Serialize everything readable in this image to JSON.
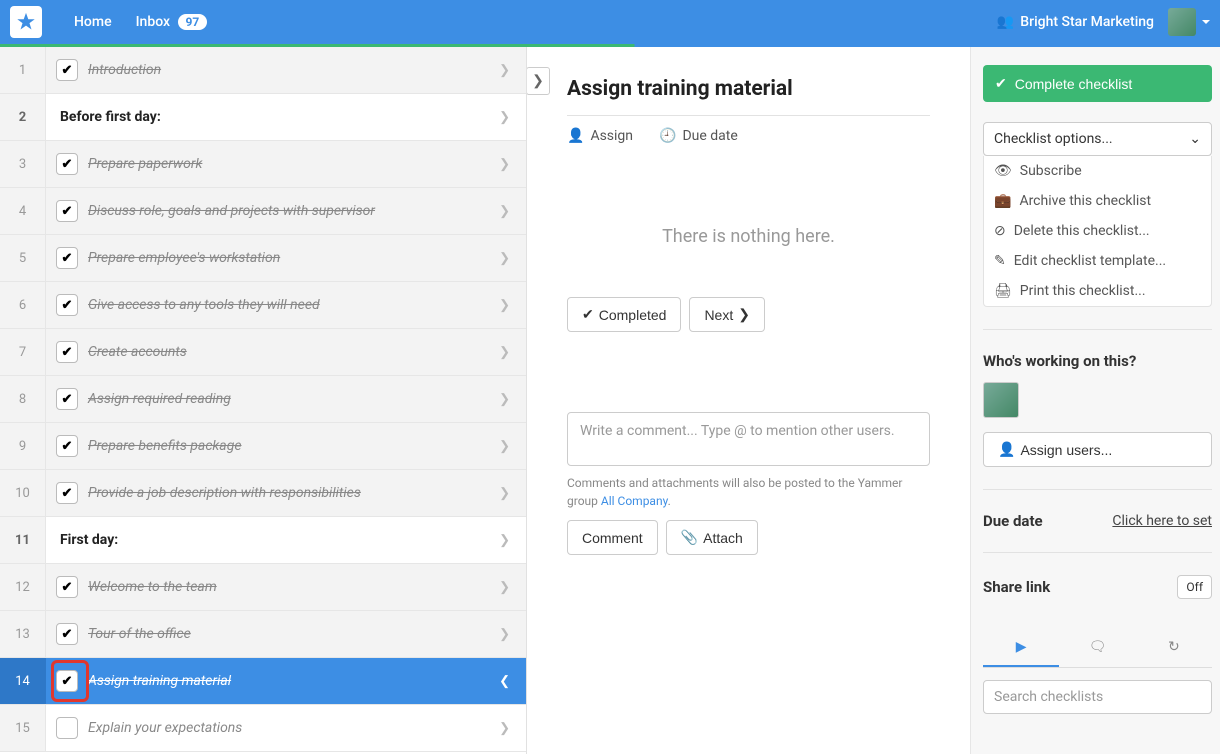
{
  "topbar": {
    "home": "Home",
    "inbox": "Inbox",
    "inbox_count": "97",
    "org_name": "Bright Star Marketing"
  },
  "tasks": [
    {
      "num": "1",
      "title": "Introduction",
      "checked": true,
      "done": true,
      "header": false
    },
    {
      "num": "2",
      "title": "Before first day:",
      "checked": false,
      "done": false,
      "header": true
    },
    {
      "num": "3",
      "title": "Prepare paperwork",
      "checked": true,
      "done": true,
      "header": false
    },
    {
      "num": "4",
      "title": "Discuss role, goals and projects with supervisor",
      "checked": true,
      "done": true,
      "header": false
    },
    {
      "num": "5",
      "title": "Prepare employee's workstation",
      "checked": true,
      "done": true,
      "header": false
    },
    {
      "num": "6",
      "title": "Give access to any tools they will need",
      "checked": true,
      "done": true,
      "header": false
    },
    {
      "num": "7",
      "title": "Create accounts",
      "checked": true,
      "done": true,
      "header": false
    },
    {
      "num": "8",
      "title": "Assign required reading",
      "checked": true,
      "done": true,
      "header": false
    },
    {
      "num": "9",
      "title": "Prepare benefits package",
      "checked": true,
      "done": true,
      "header": false
    },
    {
      "num": "10",
      "title": "Provide a job description with responsibilities",
      "checked": true,
      "done": true,
      "header": false
    },
    {
      "num": "11",
      "title": "First day:",
      "checked": false,
      "done": false,
      "header": true
    },
    {
      "num": "12",
      "title": "Welcome to the team",
      "checked": true,
      "done": true,
      "header": false
    },
    {
      "num": "13",
      "title": "Tour of the office",
      "checked": true,
      "done": true,
      "header": false
    },
    {
      "num": "14",
      "title": "Assign training material",
      "checked": true,
      "done": true,
      "header": false,
      "selected": true
    },
    {
      "num": "15",
      "title": "Explain your expectations",
      "checked": false,
      "done": false,
      "header": false
    }
  ],
  "detail": {
    "title": "Assign training material",
    "assign_label": "Assign",
    "duedate_label": "Due date",
    "empty": "There is nothing here.",
    "completed_btn": "Completed",
    "next_btn": "Next",
    "comment_placeholder": "Write a comment... Type @ to mention other users.",
    "comment_hint_pre": "Comments and attachments will also be posted to the Yammer group ",
    "comment_hint_link": "All Company",
    "comment_btn": "Comment",
    "attach_btn": "Attach"
  },
  "sidebar": {
    "complete_btn": "Complete checklist",
    "options_label": "Checklist options...",
    "menu": {
      "subscribe": "Subscribe",
      "archive": "Archive this checklist",
      "delete": "Delete this checklist...",
      "edit": "Edit checklist template...",
      "print": "Print this checklist..."
    },
    "working_heading": "Who's working on this?",
    "assign_users_btn": "Assign users...",
    "due_heading": "Due date",
    "due_action": "Click here to set",
    "share_heading": "Share link",
    "share_state": "Off",
    "search_placeholder": "Search checklists"
  }
}
